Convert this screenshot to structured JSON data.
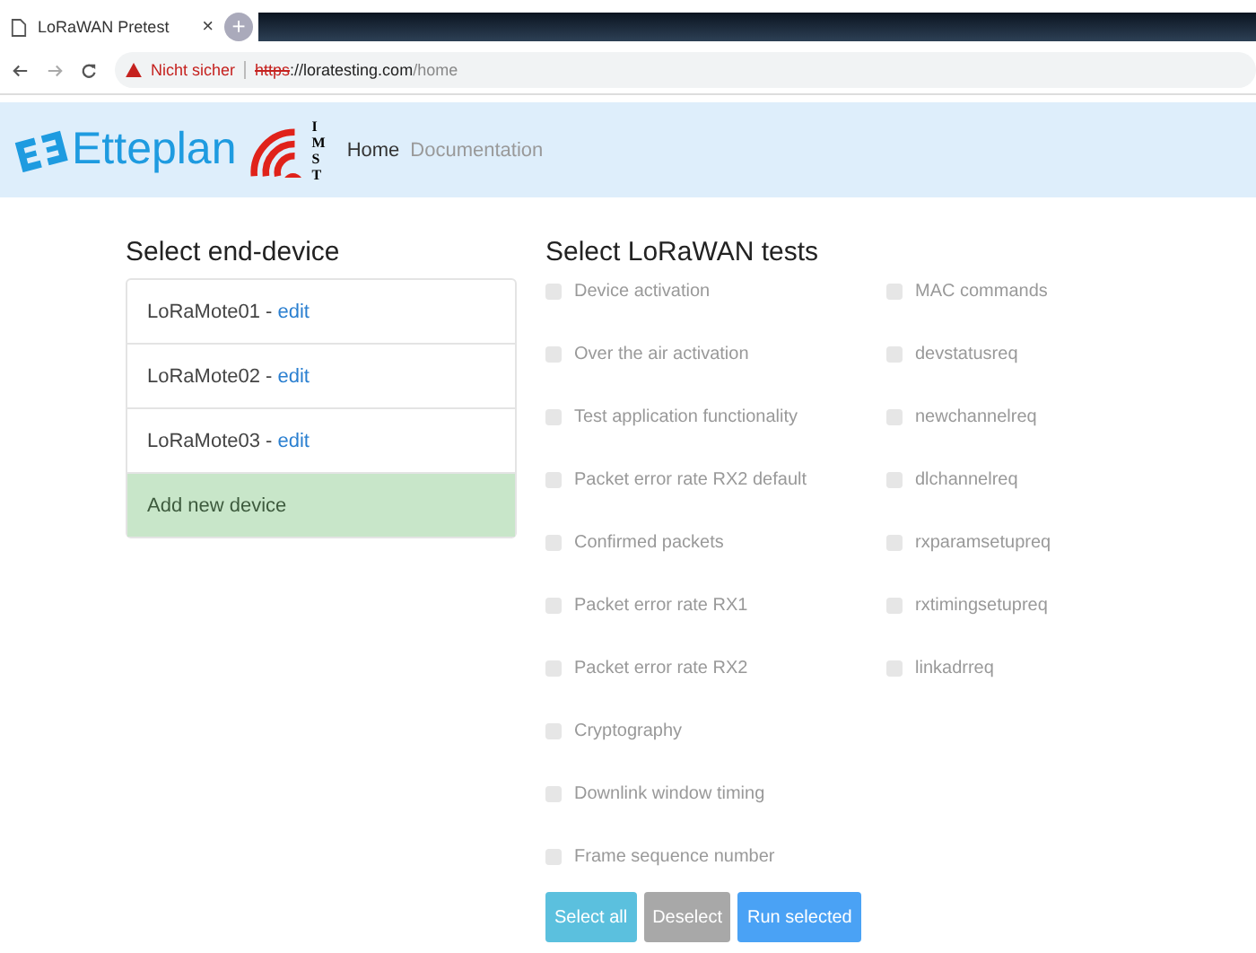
{
  "browser": {
    "tab_title": "LoRaWAN Pretest",
    "tab_close": "×",
    "new_tab": "+",
    "security": "Nicht sicher",
    "url_scheme": "https",
    "url_host": "://loratesting.com",
    "url_path": "/home"
  },
  "header": {
    "brand": "Etteplan",
    "partner_letters": [
      "I",
      "M",
      "S",
      "T"
    ],
    "nav": [
      {
        "label": "Home",
        "selected": true
      },
      {
        "label": "Documentation",
        "selected": false
      }
    ]
  },
  "devices": {
    "title": "Select end-device",
    "items": [
      {
        "kind": "device",
        "name": "LoRaMote01",
        "separator": " - ",
        "link": "edit"
      },
      {
        "kind": "device",
        "name": "LoRaMote02",
        "separator": " - ",
        "link": "edit"
      },
      {
        "kind": "device",
        "name": "LoRaMote03",
        "separator": " - ",
        "link": "edit"
      },
      {
        "kind": "add",
        "name": "Add new device"
      }
    ]
  },
  "tests": {
    "title": "Select LoRaWAN tests",
    "columns": [
      [
        {
          "label": "Device activation",
          "checked": false
        },
        {
          "label": "Over the air activation",
          "checked": false
        },
        {
          "label": "Test application functionality",
          "checked": false
        },
        {
          "label": "Packet error rate RX2 default",
          "checked": false
        },
        {
          "label": "Confirmed packets",
          "checked": false
        },
        {
          "label": "Packet error rate RX1",
          "checked": false
        },
        {
          "label": "Packet error rate RX2",
          "checked": false
        },
        {
          "label": "Cryptography",
          "checked": false
        },
        {
          "label": "Downlink window timing",
          "checked": false
        },
        {
          "label": "Frame sequence number",
          "checked": false
        }
      ],
      [
        {
          "label": "MAC commands",
          "checked": false
        },
        {
          "label": "devstatusreq",
          "checked": false
        },
        {
          "label": "newchannelreq",
          "checked": false
        },
        {
          "label": "dlchannelreq",
          "checked": false
        },
        {
          "label": "rxparamsetupreq",
          "checked": false
        },
        {
          "label": "rxtimingsetupreq",
          "checked": false
        },
        {
          "label": "linkadrreq",
          "checked": false
        }
      ]
    ],
    "buttons": [
      {
        "kind": "info",
        "label": "Select all"
      },
      {
        "kind": "secondary",
        "label": "Deselect"
      },
      {
        "kind": "primary",
        "label": "Run selected"
      }
    ]
  }
}
